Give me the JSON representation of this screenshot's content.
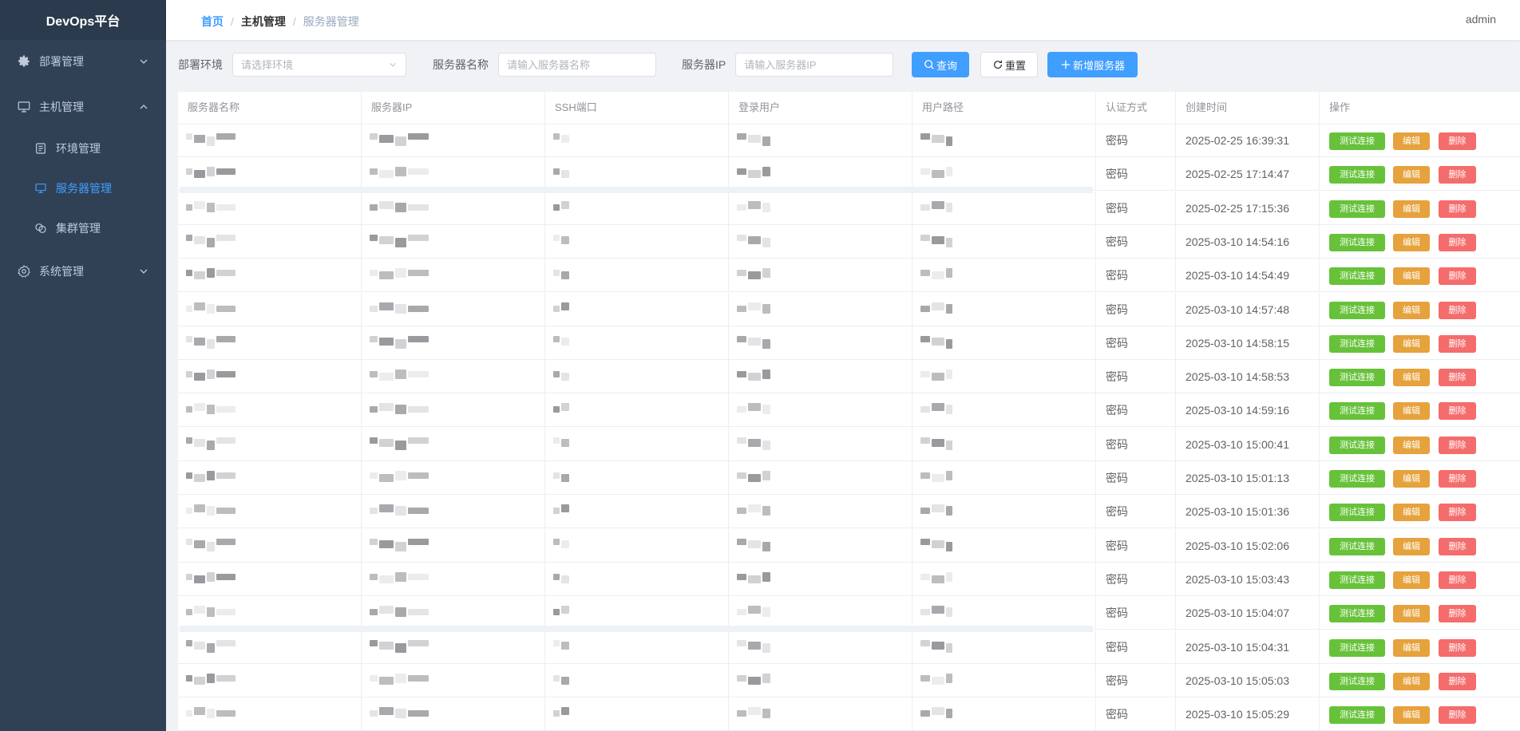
{
  "app": {
    "title": "DevOps平台"
  },
  "sidebar": {
    "items": [
      {
        "label": "部署管理",
        "icon": "gear-icon"
      },
      {
        "label": "主机管理",
        "icon": "monitor-icon"
      },
      {
        "label": "环境管理",
        "icon": "document-icon"
      },
      {
        "label": "服务器管理",
        "icon": "monitor-icon"
      },
      {
        "label": "集群管理",
        "icon": "chat-icon"
      },
      {
        "label": "系统管理",
        "icon": "gear-outline-icon"
      }
    ]
  },
  "header": {
    "breadcrumb": {
      "home": "首页",
      "parent": "主机管理",
      "current": "服务器管理"
    },
    "user": "admin"
  },
  "filters": {
    "env_label": "部署环境",
    "env_placeholder": "请选择环境",
    "name_label": "服务器名称",
    "name_placeholder": "请输入服务器名称",
    "ip_label": "服务器IP",
    "ip_placeholder": "请输入服务器IP",
    "search_btn": "查询",
    "reset_btn": "重置",
    "add_btn": "新增服务器"
  },
  "table": {
    "columns": [
      "服务器名称",
      "服务器IP",
      "SSH端口",
      "登录用户",
      "用户路径",
      "认证方式",
      "创建时间",
      "操作"
    ],
    "actions": {
      "test": "测试连接",
      "edit": "编辑",
      "delete": "删除"
    },
    "rows": [
      {
        "auth": "密码",
        "created": "2025-02-25 16:39:31"
      },
      {
        "auth": "密码",
        "created": "2025-02-25 17:14:47"
      },
      {
        "auth": "密码",
        "created": "2025-02-25 17:15:36"
      },
      {
        "auth": "密码",
        "created": "2025-03-10 14:54:16"
      },
      {
        "auth": "密码",
        "created": "2025-03-10 14:54:49"
      },
      {
        "auth": "密码",
        "created": "2025-03-10 14:57:48"
      },
      {
        "auth": "密码",
        "created": "2025-03-10 14:58:15"
      },
      {
        "auth": "密码",
        "created": "2025-03-10 14:58:53"
      },
      {
        "auth": "密码",
        "created": "2025-03-10 14:59:16"
      },
      {
        "auth": "密码",
        "created": "2025-03-10 15:00:41"
      },
      {
        "auth": "密码",
        "created": "2025-03-10 15:01:13"
      },
      {
        "auth": "密码",
        "created": "2025-03-10 15:01:36"
      },
      {
        "auth": "密码",
        "created": "2025-03-10 15:02:06"
      },
      {
        "auth": "密码",
        "created": "2025-03-10 15:03:43"
      },
      {
        "auth": "密码",
        "created": "2025-03-10 15:04:07"
      },
      {
        "auth": "密码",
        "created": "2025-03-10 15:04:31"
      },
      {
        "auth": "密码",
        "created": "2025-03-10 15:05:03"
      },
      {
        "auth": "密码",
        "created": "2025-03-10 15:05:29"
      }
    ]
  },
  "colors": {
    "sidebar": "#304156",
    "primary": "#409eff",
    "success": "#67c23a",
    "warning": "#e6a23c",
    "danger": "#f56c6c"
  }
}
